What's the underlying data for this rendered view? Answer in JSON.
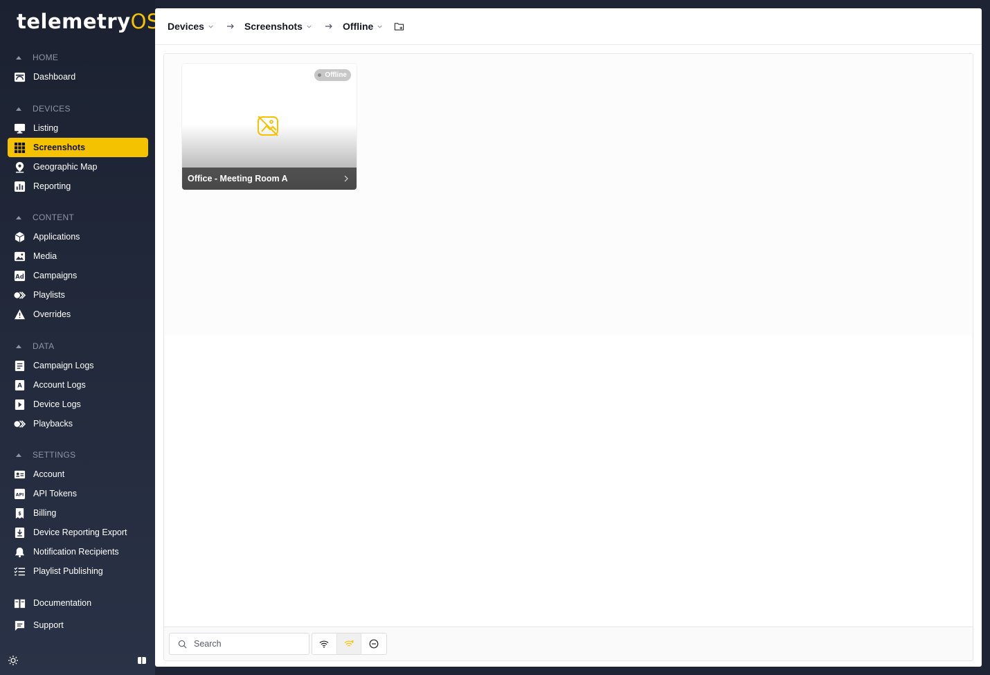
{
  "logo": {
    "brand": "telemetry",
    "suffix": "OS"
  },
  "sidebar": {
    "sections": {
      "home": "HOME",
      "devices": "DEVICES",
      "content": "CONTENT",
      "data": "DATA",
      "settings": "SETTINGS"
    },
    "items": {
      "dashboard": "Dashboard",
      "listing": "Listing",
      "screenshots": "Screenshots",
      "geographic_map": "Geographic Map",
      "reporting": "Reporting",
      "applications": "Applications",
      "media": "Media",
      "campaigns": "Campaigns",
      "playlists": "Playlists",
      "overrides": "Overrides",
      "campaign_logs": "Campaign Logs",
      "account_logs": "Account Logs",
      "device_logs": "Device Logs",
      "playbacks": "Playbacks",
      "account": "Account",
      "api_tokens": "API Tokens",
      "billing": "Billing",
      "device_reporting_export": "Device Reporting Export",
      "notification_recipients": "Notification Recipients",
      "playlist_publishing": "Playlist Publishing",
      "documentation": "Documentation",
      "support": "Support"
    },
    "active": "screenshots",
    "accent_color": "#f5c200"
  },
  "breadcrumb": {
    "devices": "Devices",
    "screenshots": "Screenshots",
    "offline": "Offline"
  },
  "cards": [
    {
      "name": "Office - Meeting Room A",
      "status": "Offline"
    }
  ],
  "filter": {
    "search_placeholder": "Search",
    "toggles": [
      "wifi-icon",
      "wifi-off-icon",
      "minus-circle-icon"
    ],
    "selected_toggle": "wifi-off-icon"
  }
}
